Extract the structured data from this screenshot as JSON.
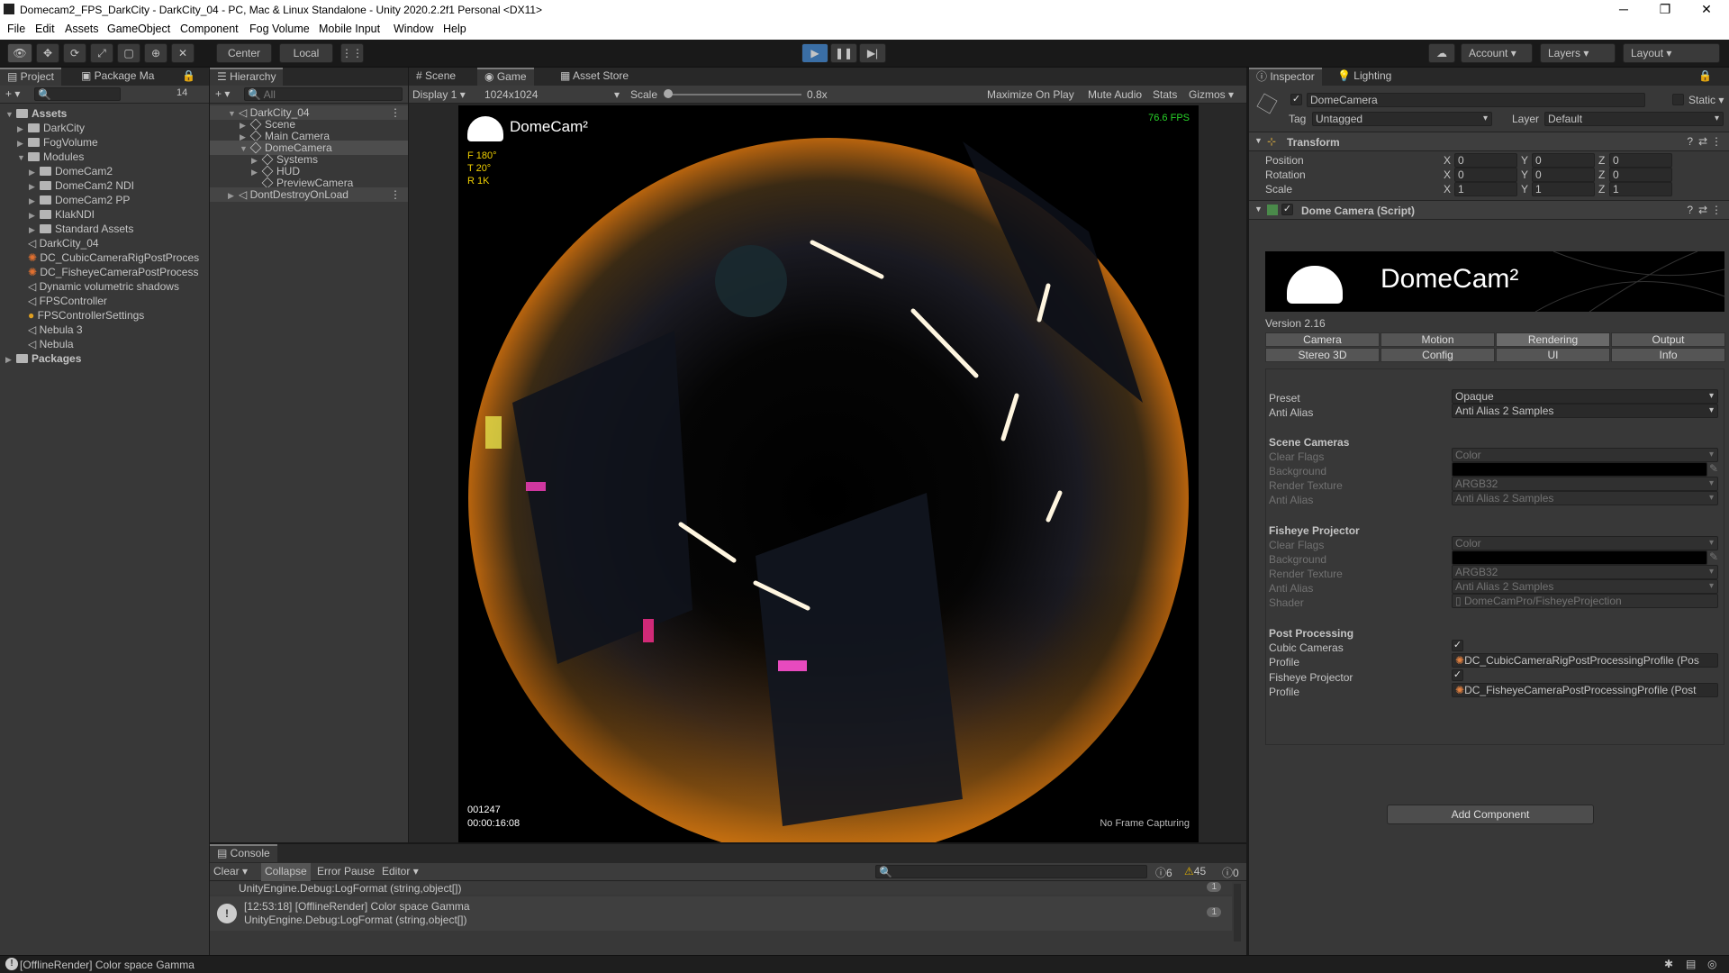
{
  "window": {
    "title": "Domecam2_FPS_DarkCity - DarkCity_04 - PC, Mac & Linux Standalone - Unity 2020.2.2f1 Personal <DX11>"
  },
  "menu": [
    "File",
    "Edit",
    "Assets",
    "GameObject",
    "Component",
    "Fog Volume",
    "Mobile Input",
    "Window",
    "Help"
  ],
  "toolbar": {
    "pivot": "Center",
    "space": "Local",
    "account": "Account",
    "layers": "Layers",
    "layout": "Layout"
  },
  "project": {
    "tabs": [
      "Project",
      "Package Ma"
    ],
    "hidden_count": "14",
    "items": [
      {
        "label": "Assets",
        "depth": 0,
        "type": "folder",
        "expanded": true,
        "bold": true
      },
      {
        "label": "DarkCity",
        "depth": 1,
        "type": "folder"
      },
      {
        "label": "FogVolume",
        "depth": 1,
        "type": "folder"
      },
      {
        "label": "Modules",
        "depth": 1,
        "type": "folder",
        "expanded": true
      },
      {
        "label": "DomeCam2",
        "depth": 2,
        "type": "folder"
      },
      {
        "label": "DomeCam2 NDI",
        "depth": 2,
        "type": "folder"
      },
      {
        "label": "DomeCam2 PP",
        "depth": 2,
        "type": "folder"
      },
      {
        "label": "KlakNDI",
        "depth": 2,
        "type": "folder"
      },
      {
        "label": "Standard Assets",
        "depth": 2,
        "type": "folder"
      },
      {
        "label": "DarkCity_04",
        "depth": 1,
        "type": "scene"
      },
      {
        "label": "DC_CubicCameraRigPostProces",
        "depth": 1,
        "type": "profile"
      },
      {
        "label": "DC_FisheyeCameraPostProcess",
        "depth": 1,
        "type": "profile"
      },
      {
        "label": "Dynamic volumetric shadows",
        "depth": 1,
        "type": "scene"
      },
      {
        "label": "FPSController",
        "depth": 1,
        "type": "scene"
      },
      {
        "label": "FPSControllerSettings",
        "depth": 1,
        "type": "settings"
      },
      {
        "label": "Nebula 3",
        "depth": 1,
        "type": "scene"
      },
      {
        "label": "Nebula",
        "depth": 1,
        "type": "scene"
      },
      {
        "label": "Packages",
        "depth": 0,
        "type": "folder",
        "bold": true
      }
    ]
  },
  "hierarchy": {
    "tab": "Hierarchy",
    "search_placeholder": "All",
    "items": [
      {
        "label": "DarkCity_04",
        "depth": 0,
        "type": "scene"
      },
      {
        "label": "Scene",
        "depth": 1
      },
      {
        "label": "Main Camera",
        "depth": 1
      },
      {
        "label": "DomeCamera",
        "depth": 1,
        "selected": true
      },
      {
        "label": "Systems",
        "depth": 2
      },
      {
        "label": "HUD",
        "depth": 2
      },
      {
        "label": "PreviewCamera",
        "depth": 2
      },
      {
        "label": "DontDestroyOnLoad",
        "depth": 0,
        "type": "scene"
      }
    ]
  },
  "game": {
    "tabs": [
      "Scene",
      "Game",
      "Asset Store"
    ],
    "display": "Display 1",
    "resolution": "1024x1024",
    "scale_label": "Scale",
    "scale_value": "0.8x",
    "toggles": [
      "Maximize On Play",
      "Mute Audio",
      "Stats",
      "Gizmos"
    ],
    "overlay": {
      "brand": "DomeCam²",
      "fps": "76.6 FPS",
      "stats": [
        "F  180°",
        "T  20°",
        "R  1K"
      ],
      "frame": "001247",
      "time": "00:00:16:08",
      "capture": "No Frame Capturing"
    }
  },
  "console": {
    "tab": "Console",
    "buttons": [
      "Clear",
      "Collapse",
      "Error Pause",
      "Editor"
    ],
    "counts": {
      "info": "6",
      "warn": "45",
      "error": "0"
    },
    "entries": [
      {
        "line1": "",
        "line2": "UnityEngine.Debug:LogFormat (string,object[])",
        "count": "1"
      },
      {
        "line1": "[12:53:18] [OfflineRender] Color space Gamma",
        "line2": "UnityEngine.Debug:LogFormat (string,object[])",
        "count": "1"
      }
    ]
  },
  "statusbar": {
    "message": "[OfflineRender] Color space Gamma"
  },
  "inspector": {
    "tabs": [
      "Inspector",
      "Lighting"
    ],
    "object_name": "DomeCamera",
    "static_label": "Static",
    "tag_label": "Tag",
    "tag_value": "Untagged",
    "layer_label": "Layer",
    "layer_value": "Default",
    "transform": {
      "title": "Transform",
      "rows": [
        {
          "label": "Position",
          "x": "0",
          "y": "0",
          "z": "0"
        },
        {
          "label": "Rotation",
          "x": "0",
          "y": "0",
          "z": "0"
        },
        {
          "label": "Scale",
          "x": "1",
          "y": "1",
          "z": "1"
        }
      ]
    },
    "script": {
      "title": "Dome Camera (Script)",
      "banner": "DomeCam²",
      "version": "Version 2.16",
      "tabs_row1": [
        "Camera",
        "Motion",
        "Rendering",
        "Output"
      ],
      "tabs_row2": [
        "Stereo 3D",
        "Config",
        "UI",
        "Info"
      ],
      "selected_tab": "Rendering",
      "preset_label": "Preset",
      "preset_value": "Opaque",
      "aa_label": "Anti Alias",
      "aa_value": "Anti Alias 2 Samples",
      "scene_cameras": {
        "title": "Scene Cameras",
        "clear_flags_label": "Clear Flags",
        "clear_flags": "Color",
        "background_label": "Background",
        "render_texture_label": "Render Texture",
        "render_texture": "ARGB32",
        "aa_label": "Anti Alias",
        "aa": "Anti Alias 2 Samples"
      },
      "fisheye": {
        "title": "Fisheye Projector",
        "clear_flags_label": "Clear Flags",
        "clear_flags": "Color",
        "background_label": "Background",
        "render_texture_label": "Render Texture",
        "render_texture": "ARGB32",
        "aa_label": "Anti Alias",
        "aa": "Anti Alias 2 Samples",
        "shader_label": "Shader",
        "shader": "DomeCamPro/FisheyeProjection"
      },
      "post": {
        "title": "Post Processing",
        "cubic_label": "Cubic Cameras",
        "profile_label": "Profile",
        "cubic_profile": "DC_CubicCameraRigPostProcessingProfile (Pos",
        "fisheye_label": "Fisheye Projector",
        "fisheye_profile": "DC_FisheyeCameraPostProcessingProfile (Post"
      }
    },
    "add_component": "Add Component"
  }
}
